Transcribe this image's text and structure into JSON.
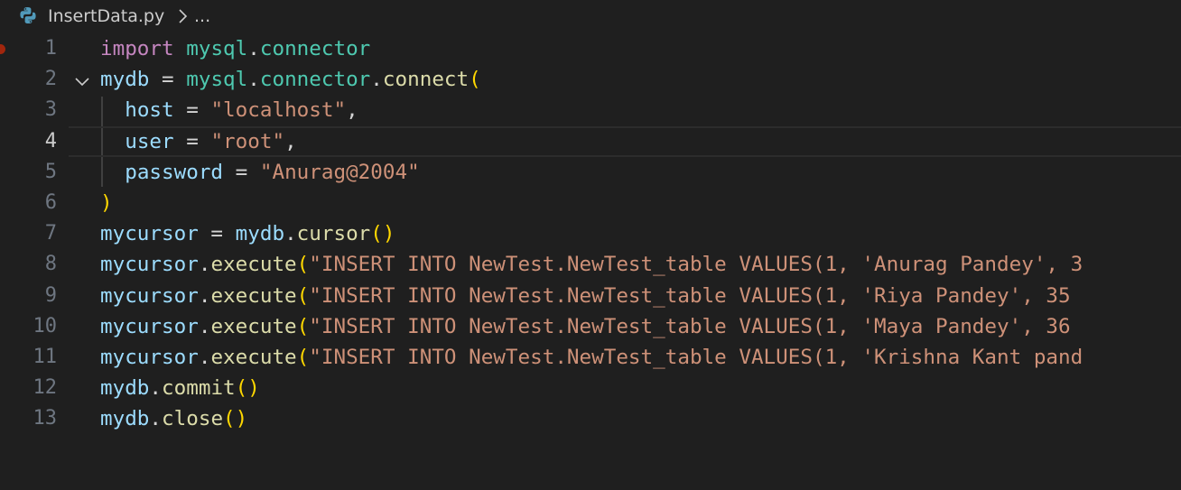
{
  "breadcrumb": {
    "file_name": "InsertData.py",
    "separator_icon": "chevron-right-icon",
    "ellipsis": "..."
  },
  "editor": {
    "language_icon": "python-icon",
    "current_line": 4,
    "breakpoint_line": 1,
    "colors": {
      "background": "#1f1f1f",
      "keyword": "#c586c0",
      "module": "#4ec9b0",
      "variable": "#9cdcfe",
      "function": "#dcdcaa",
      "string": "#ce9178",
      "bracket": "#ffd700",
      "line_number": "#6e7681",
      "breakpoint": "#a1260d"
    },
    "lines": [
      {
        "number": "1",
        "tokens": [
          {
            "t": "import",
            "c": "kw"
          },
          {
            "t": " ",
            "c": "pl"
          },
          {
            "t": "mysql",
            "c": "mod"
          },
          {
            "t": ".",
            "c": "pl"
          },
          {
            "t": "connector",
            "c": "mod"
          }
        ]
      },
      {
        "number": "2",
        "tokens": [
          {
            "t": "mydb",
            "c": "var"
          },
          {
            "t": " = ",
            "c": "pl"
          },
          {
            "t": "mysql",
            "c": "mod"
          },
          {
            "t": ".",
            "c": "pl"
          },
          {
            "t": "connector",
            "c": "mod"
          },
          {
            "t": ".",
            "c": "pl"
          },
          {
            "t": "connect",
            "c": "fn"
          },
          {
            "t": "(",
            "c": "br1"
          }
        ]
      },
      {
        "number": "3",
        "tokens": [
          {
            "t": "  ",
            "c": "pl"
          },
          {
            "t": "host",
            "c": "var"
          },
          {
            "t": " = ",
            "c": "pl"
          },
          {
            "t": "\"localhost\"",
            "c": "str"
          },
          {
            "t": ",",
            "c": "pl"
          }
        ]
      },
      {
        "number": "4",
        "tokens": [
          {
            "t": "  ",
            "c": "pl"
          },
          {
            "t": "user",
            "c": "var"
          },
          {
            "t": " = ",
            "c": "pl"
          },
          {
            "t": "\"root\"",
            "c": "str"
          },
          {
            "t": ",",
            "c": "pl"
          }
        ]
      },
      {
        "number": "5",
        "tokens": [
          {
            "t": "  ",
            "c": "pl"
          },
          {
            "t": "password",
            "c": "var"
          },
          {
            "t": " = ",
            "c": "pl"
          },
          {
            "t": "\"Anurag@2004\"",
            "c": "str"
          }
        ]
      },
      {
        "number": "6",
        "tokens": [
          {
            "t": ")",
            "c": "br1"
          }
        ]
      },
      {
        "number": "7",
        "tokens": [
          {
            "t": "mycursor",
            "c": "var"
          },
          {
            "t": " = ",
            "c": "pl"
          },
          {
            "t": "mydb",
            "c": "var"
          },
          {
            "t": ".",
            "c": "pl"
          },
          {
            "t": "cursor",
            "c": "fn"
          },
          {
            "t": "()",
            "c": "br1"
          }
        ]
      },
      {
        "number": "8",
        "tokens": [
          {
            "t": "mycursor",
            "c": "var"
          },
          {
            "t": ".",
            "c": "pl"
          },
          {
            "t": "execute",
            "c": "fn"
          },
          {
            "t": "(",
            "c": "br1"
          },
          {
            "t": "\"INSERT INTO NewTest.NewTest_table VALUES(1, 'Anurag Pandey', 3",
            "c": "str"
          }
        ]
      },
      {
        "number": "9",
        "tokens": [
          {
            "t": "mycursor",
            "c": "var"
          },
          {
            "t": ".",
            "c": "pl"
          },
          {
            "t": "execute",
            "c": "fn"
          },
          {
            "t": "(",
            "c": "br1"
          },
          {
            "t": "\"INSERT INTO NewTest.NewTest_table VALUES(1, 'Riya Pandey', 35",
            "c": "str"
          }
        ]
      },
      {
        "number": "10",
        "tokens": [
          {
            "t": "mycursor",
            "c": "var"
          },
          {
            "t": ".",
            "c": "pl"
          },
          {
            "t": "execute",
            "c": "fn"
          },
          {
            "t": "(",
            "c": "br1"
          },
          {
            "t": "\"INSERT INTO NewTest.NewTest_table VALUES(1, 'Maya Pandey', 36",
            "c": "str"
          }
        ]
      },
      {
        "number": "11",
        "tokens": [
          {
            "t": "mycursor",
            "c": "var"
          },
          {
            "t": ".",
            "c": "pl"
          },
          {
            "t": "execute",
            "c": "fn"
          },
          {
            "t": "(",
            "c": "br1"
          },
          {
            "t": "\"INSERT INTO NewTest.NewTest_table VALUES(1, 'Krishna Kant pand",
            "c": "str"
          }
        ]
      },
      {
        "number": "12",
        "tokens": [
          {
            "t": "mydb",
            "c": "var"
          },
          {
            "t": ".",
            "c": "pl"
          },
          {
            "t": "commit",
            "c": "fn"
          },
          {
            "t": "()",
            "c": "br1"
          }
        ]
      },
      {
        "number": "13",
        "tokens": [
          {
            "t": "mydb",
            "c": "var"
          },
          {
            "t": ".",
            "c": "pl"
          },
          {
            "t": "close",
            "c": "fn"
          },
          {
            "t": "()",
            "c": "br1"
          }
        ]
      }
    ]
  }
}
